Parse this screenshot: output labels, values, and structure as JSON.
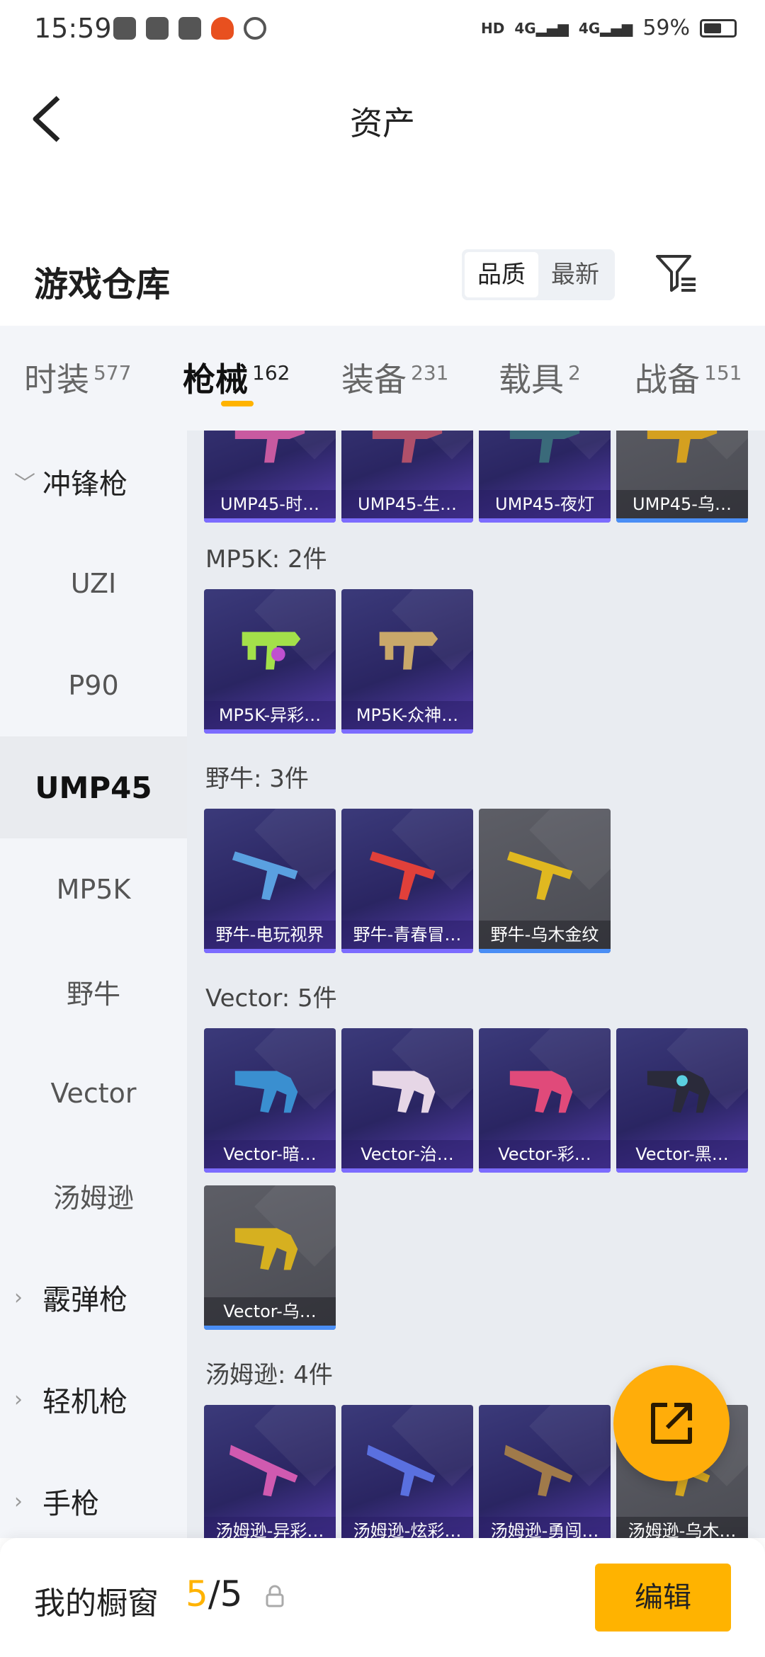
{
  "status": {
    "time": "15:59",
    "battery": "59%"
  },
  "header": {
    "title": "资产"
  },
  "warehouse": {
    "title": "游戏仓库",
    "sort_options": [
      "品质",
      "最新"
    ]
  },
  "tabs": [
    {
      "label": "时装",
      "count": "577"
    },
    {
      "label": "枪械",
      "count": "162"
    },
    {
      "label": "装备",
      "count": "231"
    },
    {
      "label": "载具",
      "count": "2"
    },
    {
      "label": "战备",
      "count": "151"
    }
  ],
  "sidebar": {
    "items": [
      "冲锋枪",
      "UZI",
      "P90",
      "UMP45",
      "MP5K",
      "野牛",
      "Vector",
      "汤姆逊",
      "霰弹枪",
      "轻机枪",
      "手枪"
    ]
  },
  "sections": {
    "ump45": {
      "items": [
        "UMP45-时…",
        "UMP45-生…",
        "UMP45-夜灯",
        "UMP45-乌…"
      ]
    },
    "mp5k": {
      "title": "MP5K: 2件",
      "items": [
        "MP5K-异彩…",
        "MP5K-众神…"
      ]
    },
    "bison": {
      "title": "野牛: 3件",
      "items": [
        "野牛-电玩视界",
        "野牛-青春冒…",
        "野牛-乌木金纹"
      ]
    },
    "vector": {
      "title": "Vector: 5件",
      "items": [
        "Vector-暗…",
        "Vector-治…",
        "Vector-彩…",
        "Vector-黑…",
        "Vector-乌…"
      ]
    },
    "thompson": {
      "title": "汤姆逊: 4件",
      "items": [
        "汤姆逊-异彩…",
        "汤姆逊-炫彩…",
        "汤姆逊-勇闯…",
        "汤姆逊-乌木…"
      ]
    }
  },
  "bottom": {
    "label": "我的橱窗",
    "current": "5",
    "total": "/5",
    "edit_label": "编辑"
  },
  "colors": {
    "accent": "#ffb300",
    "card_purple": "#2a2562",
    "card_gray": "#4a4b52"
  }
}
